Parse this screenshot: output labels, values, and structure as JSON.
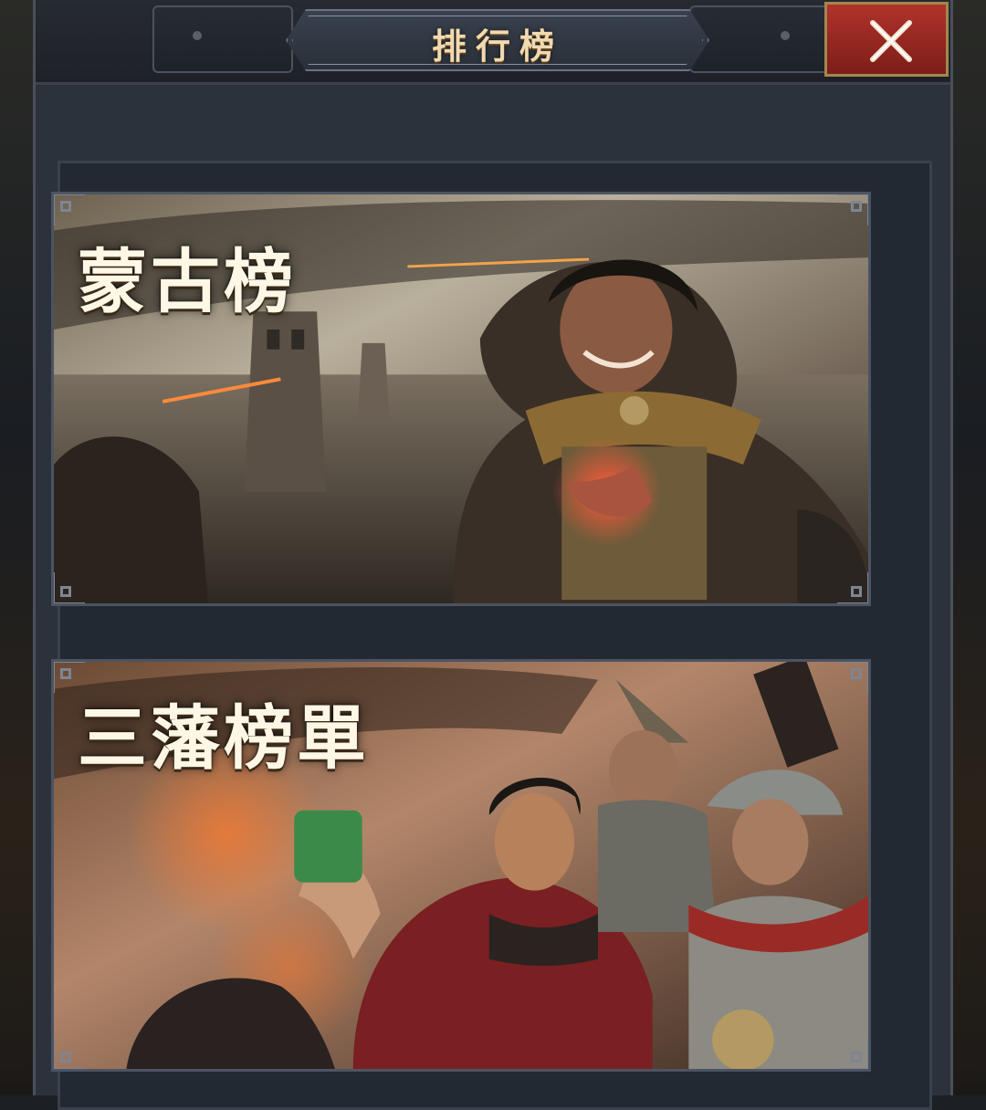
{
  "header": {
    "title": "排行榜",
    "close_icon": "close-x-icon"
  },
  "banners": [
    {
      "id": "mongol",
      "title": "蒙古榜"
    },
    {
      "id": "sanfan",
      "title": "三藩榜單"
    }
  ],
  "colors": {
    "title_gold": "#f1d9b0",
    "close_red": "#b0332b",
    "panel_slate": "#2b323c"
  }
}
